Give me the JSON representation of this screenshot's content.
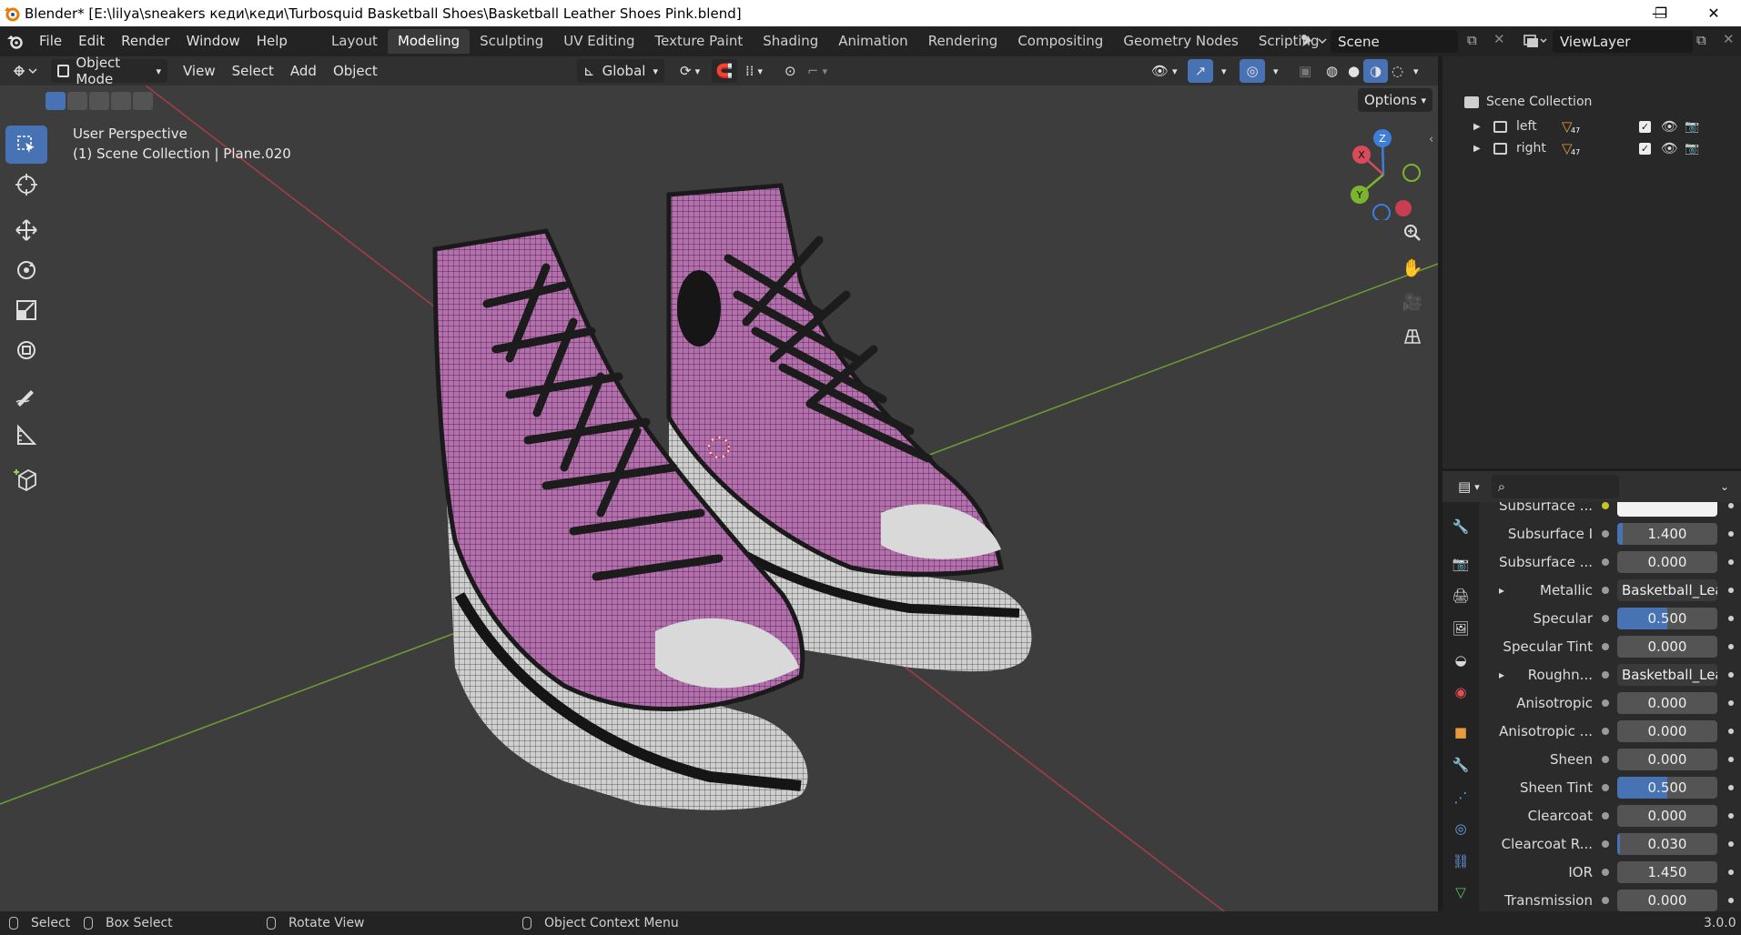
{
  "window": {
    "title": "Blender* [E:\\lilya\\sneakers кеди\\кеди\\Turbosquid Basketball Shoes\\Basketball Leather Shoes Pink.blend]",
    "minimize": "—",
    "restore": "❐",
    "close": "✕"
  },
  "menus": [
    "File",
    "Edit",
    "Render",
    "Window",
    "Help"
  ],
  "workspaces": [
    "Layout",
    "Modeling",
    "Sculpting",
    "UV Editing",
    "Texture Paint",
    "Shading",
    "Animation",
    "Rendering",
    "Compositing",
    "Geometry Nodes",
    "Scripting"
  ],
  "active_workspace": "Modeling",
  "add_workspace": "+",
  "scene": {
    "label": "Scene"
  },
  "viewlayer": {
    "label": "ViewLayer"
  },
  "viewport_header": {
    "mode": "Object Mode",
    "menus": [
      "View",
      "Select",
      "Add",
      "Object"
    ],
    "orientation": "Global",
    "options": "Options"
  },
  "viewport": {
    "perspective": "User Perspective",
    "collection_info": "(1) Scene Collection | Plane.020",
    "gizmo": {
      "x": "X",
      "y": "Y",
      "z": "Z"
    }
  },
  "outliner": {
    "root": "Scene Collection",
    "items": [
      {
        "name": "left",
        "badge": "47"
      },
      {
        "name": "right",
        "badge": "47"
      }
    ]
  },
  "properties": [
    {
      "label": "Subsurface ...",
      "value": "",
      "type": "color"
    },
    {
      "label": "Subsurface I",
      "value": "1.400",
      "fill": 0.05,
      "type": "number"
    },
    {
      "label": "Subsurface ...",
      "value": "0.000",
      "fill": 0,
      "type": "number"
    },
    {
      "label": "Metallic",
      "value": "Basketball_Lea...",
      "type": "link",
      "expand": "▸"
    },
    {
      "label": "Specular",
      "value": "0.500",
      "fill": 0.5,
      "type": "number"
    },
    {
      "label": "Specular Tint",
      "value": "0.000",
      "fill": 0,
      "type": "number"
    },
    {
      "label": "Roughn...",
      "value": "Basketball_Lea...",
      "type": "link",
      "expand": "▸"
    },
    {
      "label": "Anisotropic",
      "value": "0.000",
      "fill": 0,
      "type": "number"
    },
    {
      "label": "Anisotropic ...",
      "value": "0.000",
      "fill": 0,
      "type": "number"
    },
    {
      "label": "Sheen",
      "value": "0.000",
      "fill": 0,
      "type": "number"
    },
    {
      "label": "Sheen Tint",
      "value": "0.500",
      "fill": 0.5,
      "type": "number"
    },
    {
      "label": "Clearcoat",
      "value": "0.000",
      "fill": 0,
      "type": "number"
    },
    {
      "label": "Clearcoat R...",
      "value": "0.030",
      "fill": 0.03,
      "type": "number"
    },
    {
      "label": "IOR",
      "value": "1.450",
      "fill": 0,
      "type": "number"
    },
    {
      "label": "Transmission",
      "value": "0.000",
      "fill": 0,
      "type": "number"
    }
  ],
  "statusbar": {
    "select": "Select",
    "box_select": "Box Select",
    "rotate_view": "Rotate View",
    "context_menu": "Object Context Menu",
    "version": "3.0.0"
  },
  "colors": {
    "accent": "#4772b3",
    "shoe_canvas": "#b56fae",
    "axis_x": "#c43c4a",
    "axis_y": "#6ea136"
  }
}
